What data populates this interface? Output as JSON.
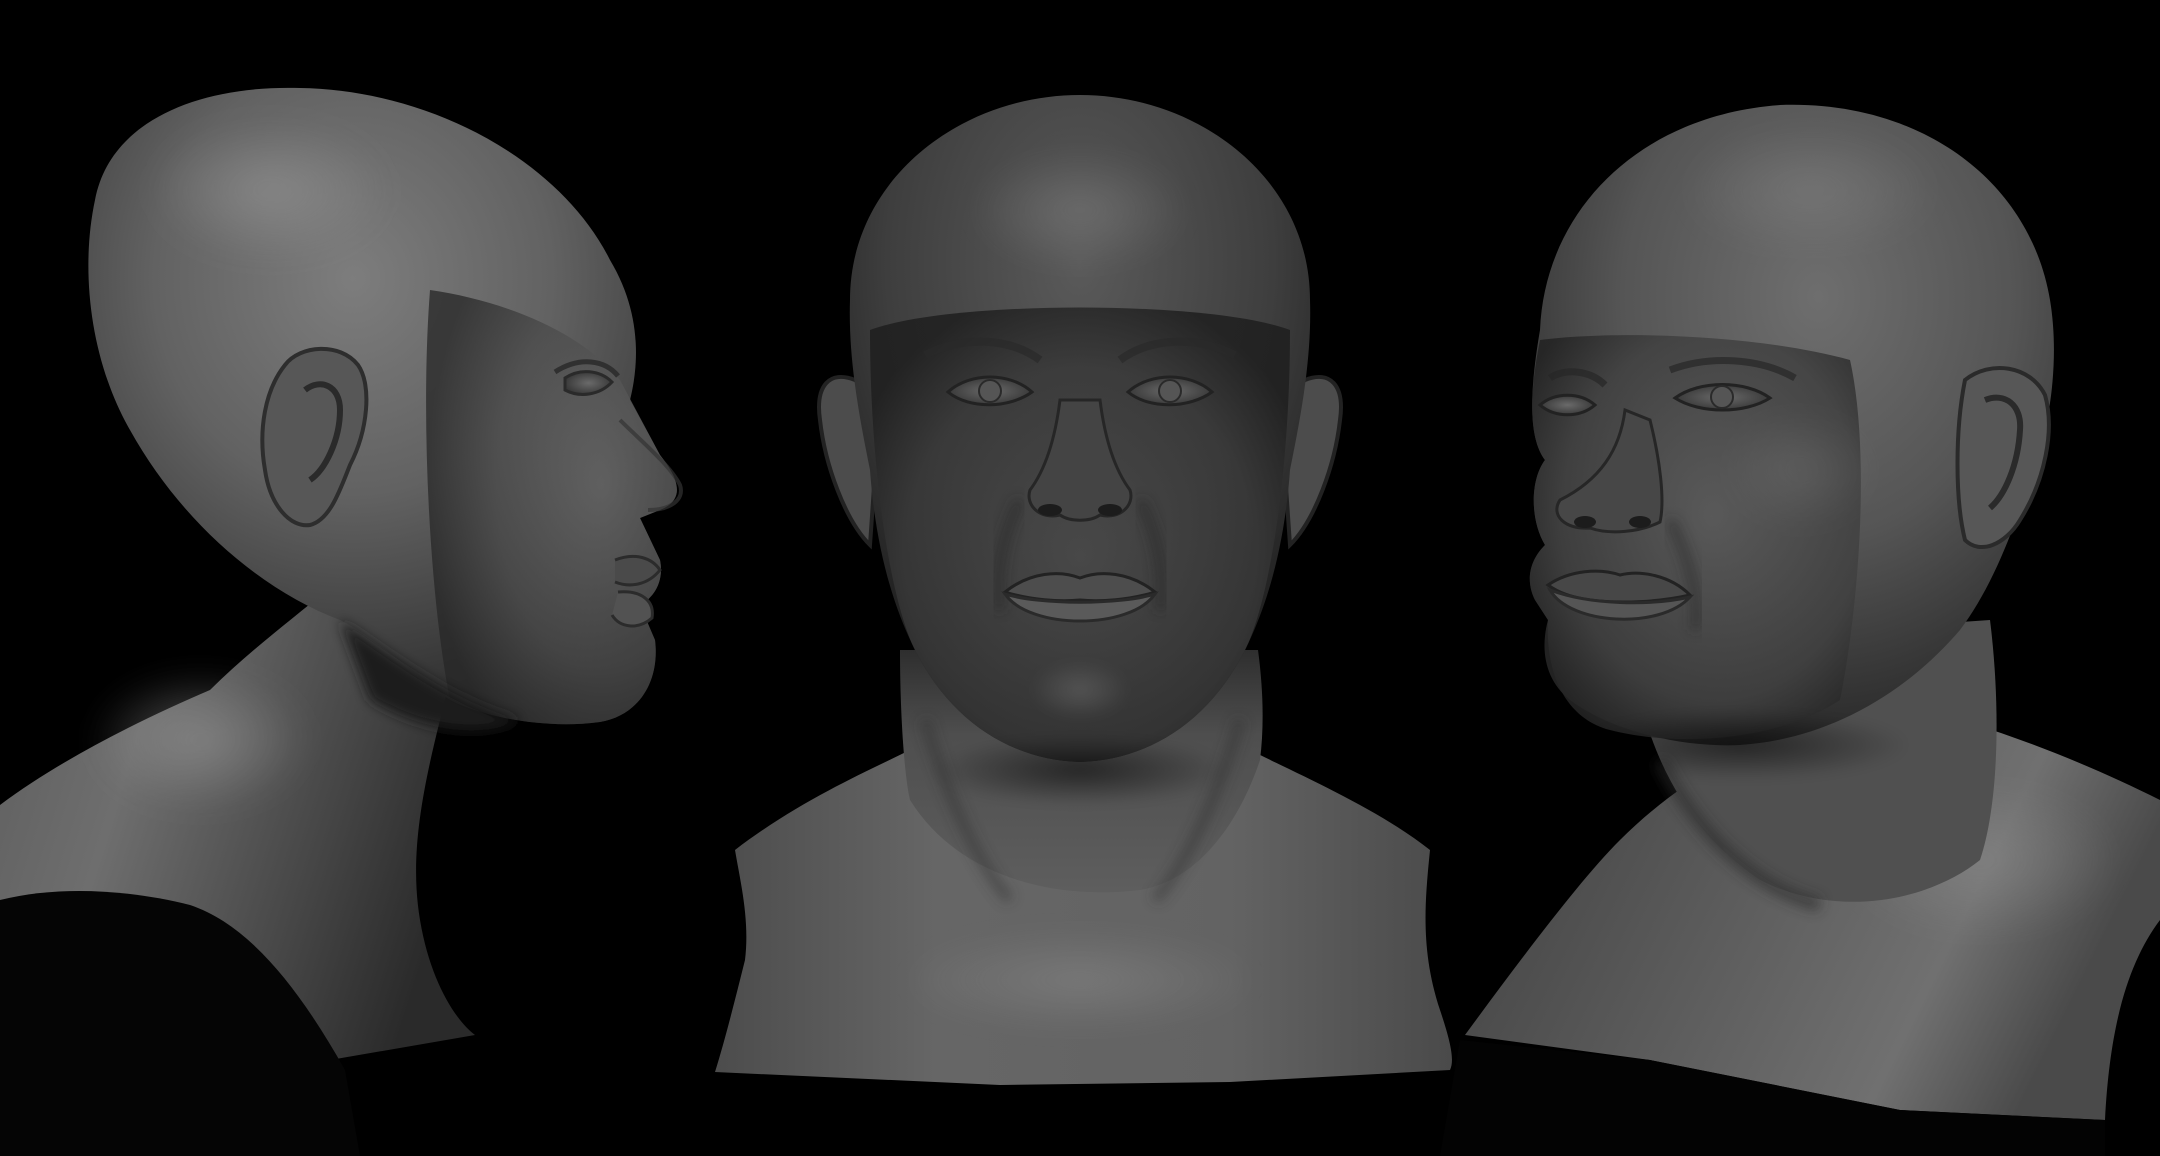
{
  "scene": {
    "background_color": "#000000",
    "clay_color": "#5e5e5e",
    "views": [
      {
        "id": "profile-right",
        "facing": "right"
      },
      {
        "id": "front",
        "facing": "front"
      },
      {
        "id": "three-quarter-left",
        "facing": "left"
      }
    ]
  }
}
